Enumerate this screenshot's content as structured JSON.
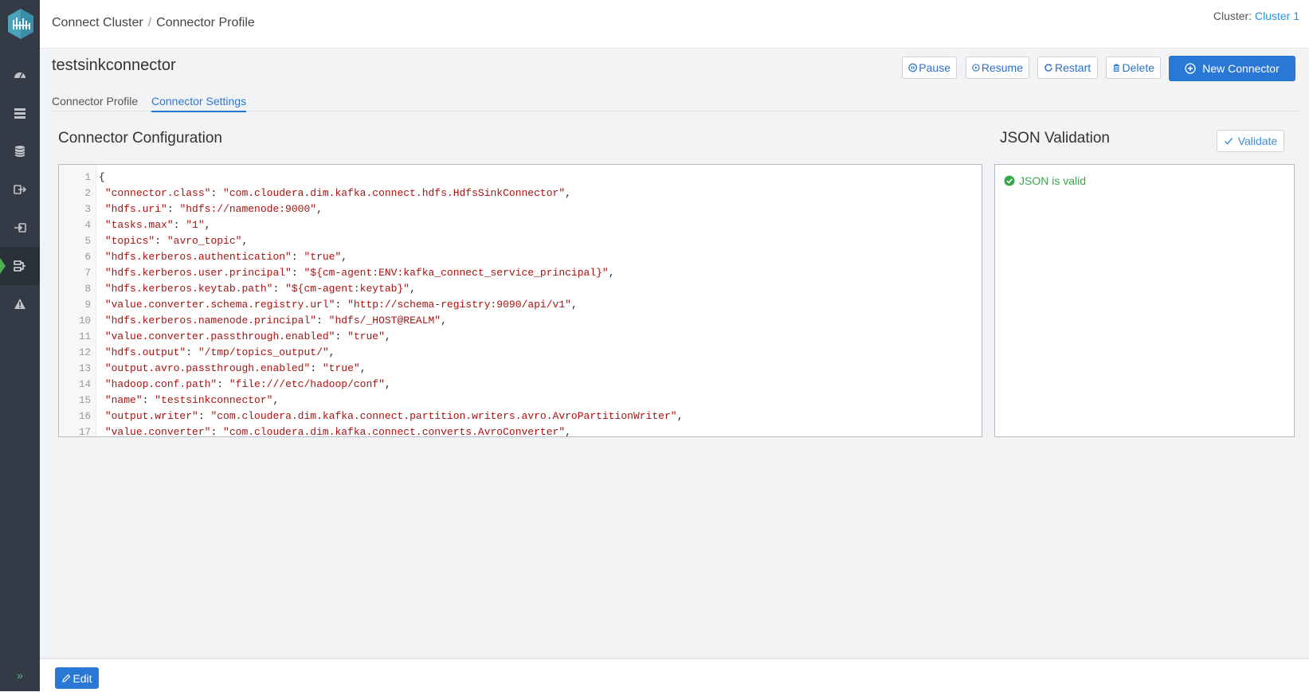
{
  "header": {
    "breadcrumb": [
      "Connect Cluster",
      "Connector Profile"
    ],
    "breadcrumb_sep": "/",
    "cluster_label": "Cluster:",
    "cluster_name": "Cluster 1"
  },
  "page": {
    "title": "testsinkconnector",
    "actions": {
      "pause": "Pause",
      "resume": "Resume",
      "restart": "Restart",
      "delete": "Delete",
      "new_connector": "New Connector"
    }
  },
  "tabs": [
    {
      "label": "Connector Profile",
      "active": false
    },
    {
      "label": "Connector Settings",
      "active": true
    }
  ],
  "config": {
    "title": "Connector Configuration",
    "lines": [
      [
        {
          "t": "p",
          "v": "{"
        }
      ],
      [
        {
          "t": "p",
          "v": " "
        },
        {
          "t": "k",
          "v": "\"connector.class\""
        },
        {
          "t": "p",
          "v": ": "
        },
        {
          "t": "k",
          "v": "\"com.cloudera.dim.kafka.connect.hdfs.HdfsSinkConnector\""
        },
        {
          "t": "p",
          "v": ","
        }
      ],
      [
        {
          "t": "p",
          "v": " "
        },
        {
          "t": "k",
          "v": "\"hdfs.uri\""
        },
        {
          "t": "p",
          "v": ": "
        },
        {
          "t": "k",
          "v": "\"hdfs://namenode:9000\""
        },
        {
          "t": "p",
          "v": ","
        }
      ],
      [
        {
          "t": "p",
          "v": " "
        },
        {
          "t": "k",
          "v": "\"tasks.max\""
        },
        {
          "t": "p",
          "v": ": "
        },
        {
          "t": "k",
          "v": "\"1\""
        },
        {
          "t": "p",
          "v": ","
        }
      ],
      [
        {
          "t": "p",
          "v": " "
        },
        {
          "t": "k",
          "v": "\"topics\""
        },
        {
          "t": "p",
          "v": ": "
        },
        {
          "t": "k",
          "v": "\"avro_topic\""
        },
        {
          "t": "p",
          "v": ","
        }
      ],
      [
        {
          "t": "p",
          "v": " "
        },
        {
          "t": "k",
          "v": "\"hdfs.kerberos.authentication\""
        },
        {
          "t": "p",
          "v": ": "
        },
        {
          "t": "k",
          "v": "\"true\""
        },
        {
          "t": "p",
          "v": ","
        }
      ],
      [
        {
          "t": "p",
          "v": " "
        },
        {
          "t": "k",
          "v": "\"hdfs.kerberos.user.principal\""
        },
        {
          "t": "p",
          "v": ": "
        },
        {
          "t": "k",
          "v": "\"${cm-agent:ENV:kafka_connect_service_principal}\""
        },
        {
          "t": "p",
          "v": ","
        }
      ],
      [
        {
          "t": "p",
          "v": " "
        },
        {
          "t": "k",
          "v": "\"hdfs.kerberos.keytab.path\""
        },
        {
          "t": "p",
          "v": ": "
        },
        {
          "t": "k",
          "v": "\"${cm-agent:keytab}\""
        },
        {
          "t": "p",
          "v": ","
        }
      ],
      [
        {
          "t": "p",
          "v": " "
        },
        {
          "t": "k",
          "v": "\"value.converter.schema.registry.url\""
        },
        {
          "t": "p",
          "v": ": "
        },
        {
          "t": "k",
          "v": "\"http://schema-registry:9090/api/v1\""
        },
        {
          "t": "p",
          "v": ","
        }
      ],
      [
        {
          "t": "p",
          "v": " "
        },
        {
          "t": "k",
          "v": "\"hdfs.kerberos.namenode.principal\""
        },
        {
          "t": "p",
          "v": ": "
        },
        {
          "t": "k",
          "v": "\"hdfs/_HOST@REALM\""
        },
        {
          "t": "p",
          "v": ","
        }
      ],
      [
        {
          "t": "p",
          "v": " "
        },
        {
          "t": "k",
          "v": "\"value.converter.passthrough.enabled\""
        },
        {
          "t": "p",
          "v": ": "
        },
        {
          "t": "k",
          "v": "\"true\""
        },
        {
          "t": "p",
          "v": ","
        }
      ],
      [
        {
          "t": "p",
          "v": " "
        },
        {
          "t": "k",
          "v": "\"hdfs.output\""
        },
        {
          "t": "p",
          "v": ": "
        },
        {
          "t": "k",
          "v": "\"/tmp/topics_output/\""
        },
        {
          "t": "p",
          "v": ","
        }
      ],
      [
        {
          "t": "p",
          "v": " "
        },
        {
          "t": "k",
          "v": "\"output.avro.passthrough.enabled\""
        },
        {
          "t": "p",
          "v": ": "
        },
        {
          "t": "k",
          "v": "\"true\""
        },
        {
          "t": "p",
          "v": ","
        }
      ],
      [
        {
          "t": "p",
          "v": " "
        },
        {
          "t": "k",
          "v": "\"hadoop.conf.path\""
        },
        {
          "t": "p",
          "v": ": "
        },
        {
          "t": "k",
          "v": "\"file:///etc/hadoop/conf\""
        },
        {
          "t": "p",
          "v": ","
        }
      ],
      [
        {
          "t": "p",
          "v": " "
        },
        {
          "t": "k",
          "v": "\"name\""
        },
        {
          "t": "p",
          "v": ": "
        },
        {
          "t": "k",
          "v": "\"testsinkconnector\""
        },
        {
          "t": "p",
          "v": ","
        }
      ],
      [
        {
          "t": "p",
          "v": " "
        },
        {
          "t": "k",
          "v": "\"output.writer\""
        },
        {
          "t": "p",
          "v": ": "
        },
        {
          "t": "k",
          "v": "\"com.cloudera.dim.kafka.connect.partition.writers.avro.AvroPartitionWriter\""
        },
        {
          "t": "p",
          "v": ","
        }
      ],
      [
        {
          "t": "p",
          "v": " "
        },
        {
          "t": "k",
          "v": "\"value.converter\""
        },
        {
          "t": "p",
          "v": ": "
        },
        {
          "t": "k",
          "v": "\"com.cloudera.dim.kafka.connect.converts.AvroConverter\""
        },
        {
          "t": "p",
          "v": ","
        }
      ]
    ]
  },
  "validation": {
    "title": "JSON Validation",
    "validate_label": "Validate",
    "message": "JSON is valid"
  },
  "footer": {
    "edit_label": "Edit"
  },
  "colors": {
    "sidebar": "#343b46",
    "primary": "#2a78d6",
    "link": "#2a91d6",
    "json_string": "#aa1111",
    "valid": "#3aa64c",
    "active_marker": "#4caf50"
  },
  "sidebar": {
    "icons": [
      "dashboard-icon",
      "brokers-icon",
      "database-icon",
      "producers-icon",
      "consumers-icon",
      "connect-icon",
      "alerts-icon"
    ],
    "active": "connect-icon",
    "expand_icon": "double-chevron-right-icon"
  }
}
